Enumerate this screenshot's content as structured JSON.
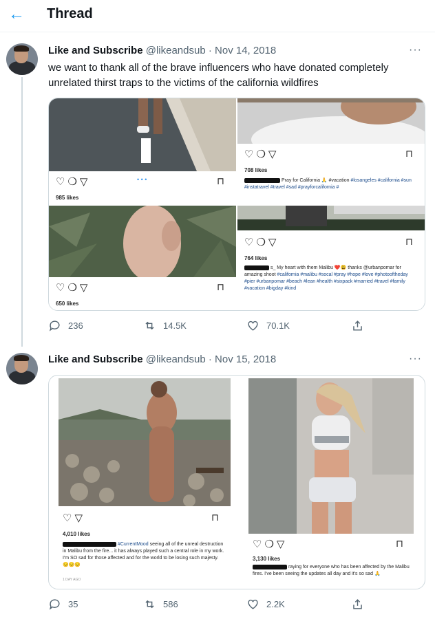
{
  "header": {
    "back_icon": "arrow-left-icon",
    "title": "Thread",
    "accent": "#1d9bf0"
  },
  "tweets": [
    {
      "name": "Like and Subscribe",
      "handle": "@likeandsub",
      "dot": "·",
      "date": "Nov 14, 2018",
      "more": "···",
      "text": "we want to thank all of the brave influencers who have donated completely unrelated thirst traps to the victims of the california wildfires",
      "posts": [
        {
          "likes": "985 likes",
          "carousel": "• • •"
        },
        {
          "likes": "708 likes",
          "caption_text": "Pray for California 🙏 #vacation",
          "caption_tags": "#losangeles #california #sun #instatravel #travel #sad #prayforcalifornia #"
        },
        {
          "likes": "650 likes"
        },
        {
          "likes": "764 likes",
          "caption_text": "s_ My heart with them Malibu ❤️😩 thanks @urbanpomar for amazing shoot",
          "caption_tags": "#california #malibu #socal #pray #hope #love #photooftheday #pier #urbanpomar #beach #lean #health #sixpack #married #travel #family #vacation #bigday #kind"
        }
      ],
      "stats": {
        "replies": "236",
        "retweets": "14.5K",
        "likes": "70.1K"
      }
    },
    {
      "name": "Like and Subscribe",
      "handle": "@likeandsub",
      "dot": "·",
      "date": "Nov 15, 2018",
      "more": "···",
      "posts": [
        {
          "likes": "4,010 likes",
          "caption_tags": "#CurrentMood",
          "caption_text": "seeing all of the unreal destruction in Malibu from the fire... it has always played such a central role in my work. I'm SO sad for those affected and for the world to be losing such majesty. 😔😔😔",
          "time": "1 DAY AGO"
        },
        {
          "likes": "3,130 likes",
          "caption_text": "raying for everyone who has been affected by the Malibu fires. I've been seeing the updates all day and it's so sad 🙏"
        }
      ],
      "stats": {
        "replies": "35",
        "retweets": "586",
        "likes": "2.2K"
      }
    }
  ]
}
